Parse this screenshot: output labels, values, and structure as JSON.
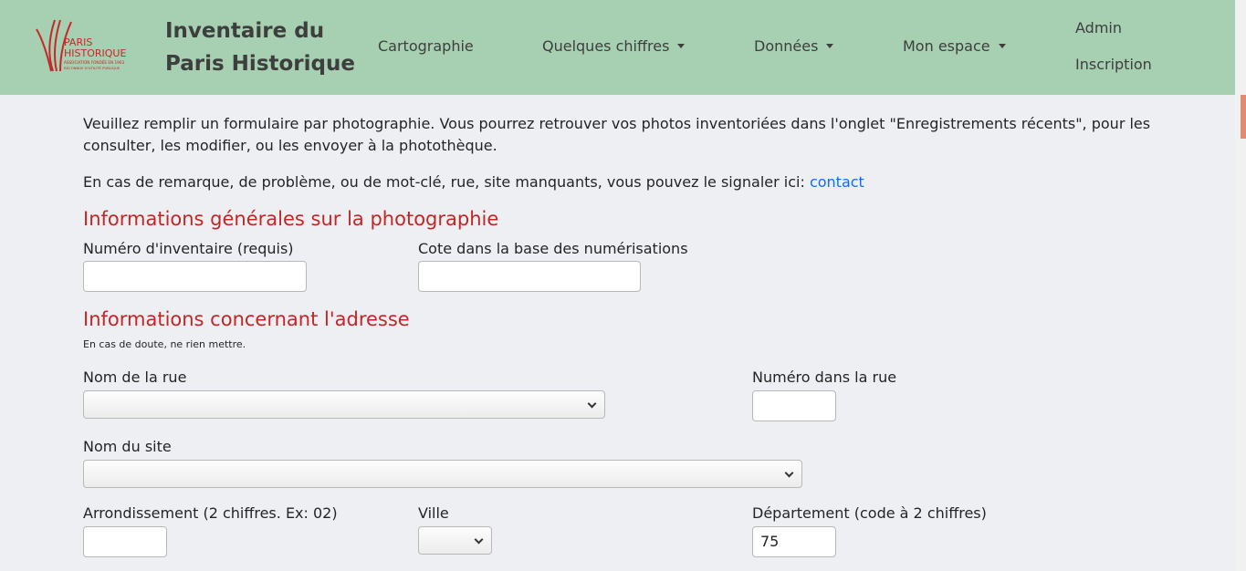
{
  "nav": {
    "brand_line1": "Inventaire du",
    "brand_line2": "Paris Historique",
    "logo_text_line1": "PARIS",
    "logo_text_line2": "HISTORIQUE",
    "logo_text_line3": "ASSOCIATION FONDÉE EN 1963",
    "logo_text_line4": "RECONNUE D'UTILITÉ PUBLIQUE",
    "items": [
      {
        "label": "Cartographie"
      },
      {
        "label": "Quelques chiffres"
      },
      {
        "label": "Données"
      },
      {
        "label": "Mon espace"
      }
    ],
    "admin": "Admin",
    "inscription": "Inscription"
  },
  "intro": {
    "text": "Veuillez remplir un formulaire par photographie. Vous pourrez retrouver vos photos inventoriées dans l'onglet \"Enregistrements récents\", pour les consulter, les modifier, ou les envoyer à la photothèque.",
    "contact_prefix": "En cas de remarque, de problème, ou de mot-clé, rue, site manquants, vous pouvez le signaler ici: ",
    "contact_link": "contact"
  },
  "section_general": {
    "title": "Informations générales sur la photographie",
    "inventory_label": "Numéro d'inventaire (requis)",
    "inventory_value": "",
    "cote_label": "Cote dans la base des numérisations",
    "cote_value": ""
  },
  "section_address": {
    "title": "Informations concernant l'adresse",
    "note": "En cas de doute, ne rien mettre.",
    "street_label": "Nom de la rue",
    "street_value": "",
    "number_label": "Numéro dans la rue",
    "number_value": "",
    "site_label": "Nom du site",
    "site_value": "",
    "arrondissement_label": "Arrondissement (2 chiffres. Ex: 02)",
    "arrondissement_value": "",
    "ville_label": "Ville",
    "ville_value": "",
    "departement_label": "Département (code à 2 chiffres)",
    "departement_value": "75"
  },
  "colors": {
    "navbar": "#a7cfb2",
    "section_title": "#c42626",
    "link": "#0d6efd",
    "page_bg": "#eeeff2"
  }
}
